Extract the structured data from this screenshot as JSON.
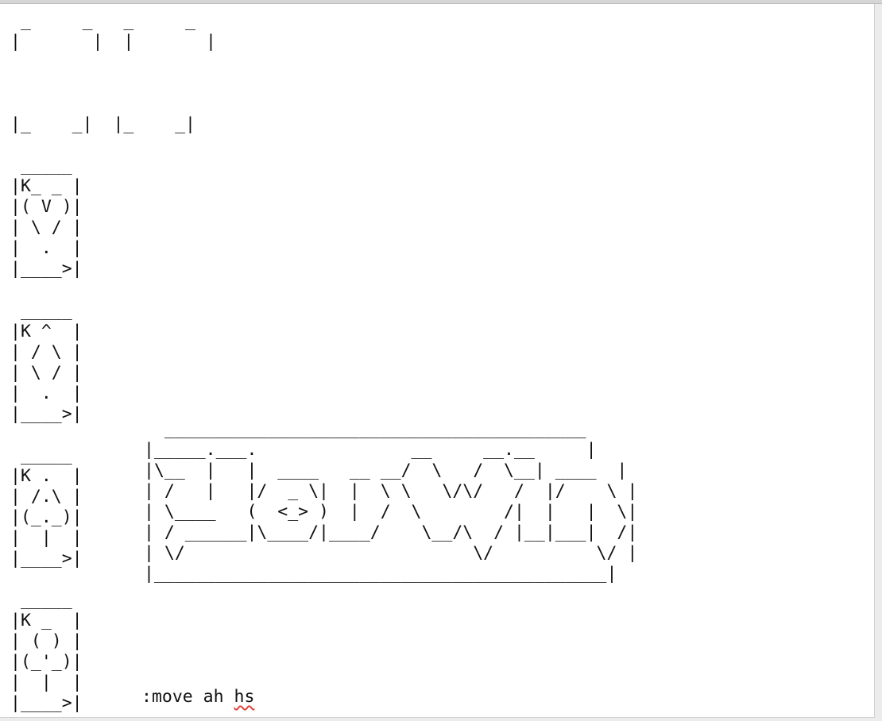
{
  "tableau": {
    "empty_slots": " _     _   _     _\n|       |  |       |\n\n\n\n|_    _|  |_    _|"
  },
  "cards": [
    {
      "name": "king-of-hearts",
      "art": " _____\n|K_ _ |\n|( V )|\n| \\ / |\n|  .  |\n|____>|"
    },
    {
      "name": "king-of-diamonds",
      "art": " _____\n|K ^  |\n| / \\ |\n| \\ / |\n|  .  |\n|____>|"
    },
    {
      "name": "king-of-spades",
      "art": " _____\n|K .  |\n| /.\\ |\n|(_._)|\n|  |  |\n|____>|"
    },
    {
      "name": "king-of-clubs",
      "art": " _____\n|K _  |\n| ( ) |\n|(_'_)|\n|  |  |\n|____>|"
    }
  ],
  "banner": {
    "art": "  _________________________________________\n|_____.___.               __     __.__     |\n|\\__  |   |  ____   __ __/  \\   /  \\__| ____  |\n| /   |   |/  _ \\|  |  \\ \\   \\/\\/   /  |/    \\ |\n| \\____   (  <_> )  |  /  \\        /|  |   |  \\|\n| / ______|\\____/|____/    \\__/\\  / |__|___|  /|\n| \\/                            \\/          \\/ |\n|____________________________________________|"
  },
  "command_line": {
    "prefix": ":move ah ",
    "word": "hs"
  }
}
